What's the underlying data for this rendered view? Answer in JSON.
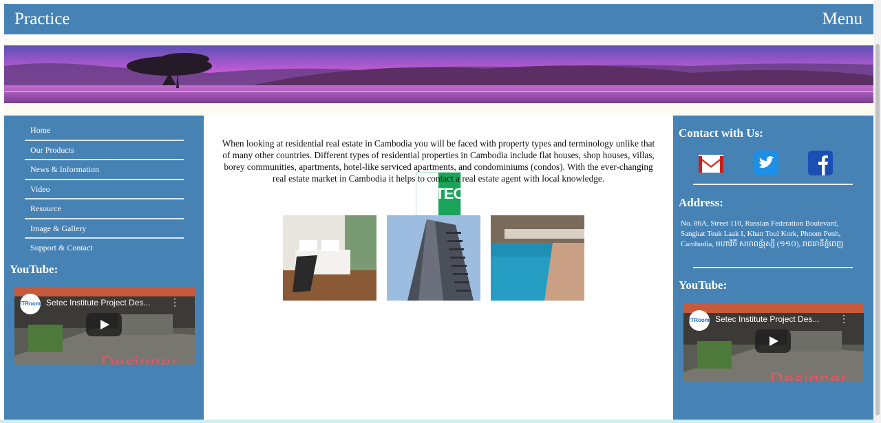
{
  "header": {
    "title": "Practice",
    "menu_label": "Menu"
  },
  "nav": {
    "items": [
      "Home",
      "Our Products",
      "News & Information",
      "Video",
      "Resource",
      "Image & Gallery",
      "Support & Contact"
    ]
  },
  "left": {
    "youtube_heading": "YouTube:"
  },
  "video": {
    "title": "Setec Institute Project Des...",
    "channel": "ITRoom",
    "overlay_text": "Designer"
  },
  "main": {
    "paragraph": "When looking at residential real estate in Cambodia you will be faced with property types and terminology unlike that of many other countries. Different types of residential properties in Cambodia include flat houses, shop houses, villas, borey communities, apartments, hotel-like serviced apartments, and condominiums (condos). With the ever-changing real estate market in Cambodia it helps to contact a real estate agent with local knowledge.",
    "logo_text": "SETEC"
  },
  "right": {
    "contact_heading": "Contact with Us:",
    "address_heading": "Address:",
    "address_text": "No. 86A, Street 110, Russian Federation Boulevard, Sangkat Teuk Laak I, Khan Toul Kork, Phnom Penh, Cambodia, មហាវិថី សហពន្ធ័រុស្សី (១១០), រាជធានីភ្នំពេញ",
    "youtube_heading": "YouTube:",
    "social_icons": [
      "gmail-icon",
      "twitter-icon",
      "facebook-icon"
    ]
  },
  "colors": {
    "primary": "#4682b4",
    "banner_bg": "#fdfaf0"
  }
}
